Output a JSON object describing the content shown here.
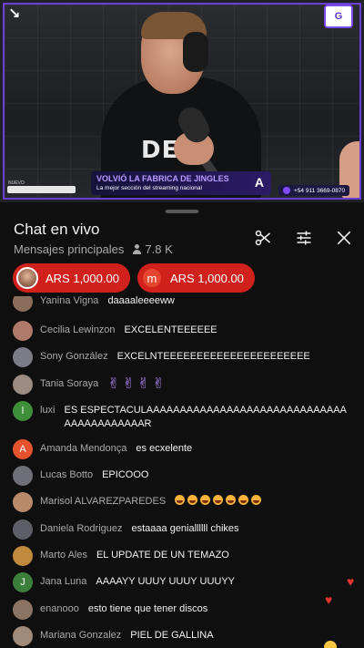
{
  "video": {
    "logo_text": "G",
    "banner_title": "VOLVIÓ LA FABRICA DE JINGLES",
    "banner_subtitle": "La mejor sección del streaming nacional",
    "banner_logo": "A",
    "phone": "+54 911 3669-0870",
    "bug_label": "NUEVO",
    "shirt_text": "DEV",
    "brand_color": "#6a3fd6"
  },
  "chat": {
    "title": "Chat en vivo",
    "subtitle": "Mensajes principales",
    "viewers": "7.8 K",
    "icons": [
      "scissors-icon",
      "tune-icon",
      "close-icon"
    ],
    "pinned": [
      {
        "avatar": "photo",
        "amount": "ARS 1,000.00"
      },
      {
        "avatar_letter": "m",
        "amount": "ARS 1,000.00"
      }
    ],
    "messages": [
      {
        "author": "Yanina Vigna",
        "text": "daaaaleeeeww",
        "avatar_color": "#8a6d5a"
      },
      {
        "author": "Cecilia Lewinzon",
        "text": "EXCELENTEEEEEE",
        "avatar_color": "#b07a6a"
      },
      {
        "author": "Sony González",
        "text": "EXCELNTEEEEEEEEEEEEEEEEEEEEEE",
        "avatar_color": "#7c7c86"
      },
      {
        "author": "Tania Soraya",
        "text": "",
        "emoji": "✌️✌️✌️✌️",
        "avatar_color": "#9c8c82"
      },
      {
        "author": "luxi",
        "text": "ES ESPECTACULAAAAAAAAAAAAAAAAAAAAAAAAAAAAAAAAAAAAAAAAAAR",
        "avatar_letter": "l",
        "avatar_color": "#3f8f3a"
      },
      {
        "author": "Amanda Mendonça",
        "text": "es ecxelente",
        "avatar_letter": "A",
        "avatar_color": "#e5522d"
      },
      {
        "author": "Lucas Botto",
        "text": "EPICOOO",
        "avatar_color": "#6f6f78"
      },
      {
        "author": "Marisol ALVAREZPAREDES",
        "text": "",
        "emoji": "😍😍😍😍😍😍😍",
        "avatar_color": "#b98a6a"
      },
      {
        "author": "Daniela Rodriguez",
        "text": "estaaaa geniallllll chikes",
        "avatar_color": "#5e5e66"
      },
      {
        "author": "Marto Ales",
        "text": "EL UPDATE DE UN TEMAZO",
        "avatar_color": "#c08a3e"
      },
      {
        "author": "Jana Luna",
        "text": "AAAAYY UUUY UUUY UUUYY",
        "avatar_letter": "J",
        "avatar_color": "#3c7f3a"
      },
      {
        "author": "enanooo",
        "text": "esto tiene que tener discos",
        "avatar_color": "#8c7464"
      },
      {
        "author": "Mariana Gonzalez",
        "text": "PIEL DE GALLINA",
        "avatar_color": "#a08a7a"
      }
    ],
    "reactions": [
      "heart",
      "heart",
      "smile"
    ]
  }
}
